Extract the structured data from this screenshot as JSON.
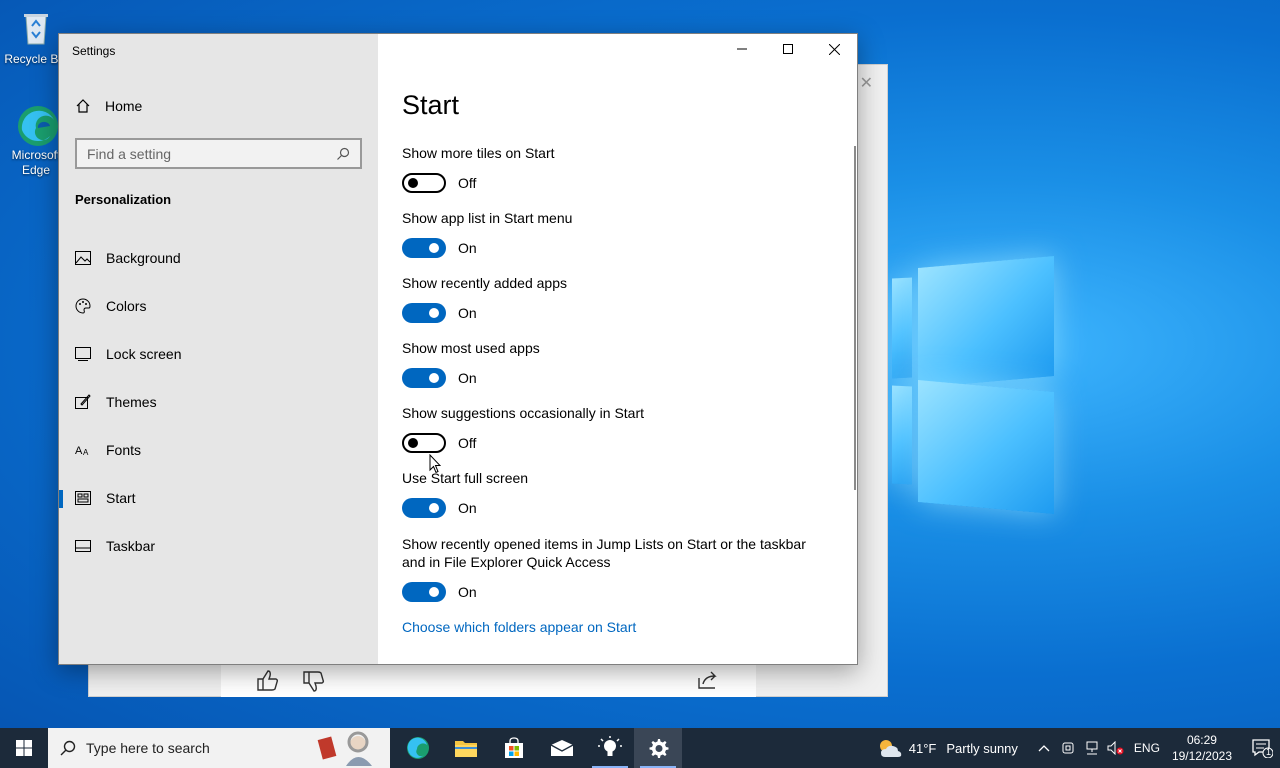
{
  "desktop": {
    "icons": [
      {
        "label": "Recycle Bin"
      },
      {
        "label": "Microsoft Edge"
      }
    ]
  },
  "window": {
    "title": "Settings",
    "controls": {
      "minimize": "minimize",
      "maximize": "maximize",
      "close": "close"
    }
  },
  "sidebar": {
    "home_label": "Home",
    "search_placeholder": "Find a setting",
    "section_label": "Personalization",
    "items": [
      {
        "label": "Background",
        "icon": "image-icon"
      },
      {
        "label": "Colors",
        "icon": "palette-icon"
      },
      {
        "label": "Lock screen",
        "icon": "lock-screen-icon"
      },
      {
        "label": "Themes",
        "icon": "themes-icon"
      },
      {
        "label": "Fonts",
        "icon": "fonts-icon"
      },
      {
        "label": "Start",
        "icon": "start-icon",
        "active": true
      },
      {
        "label": "Taskbar",
        "icon": "taskbar-icon"
      }
    ]
  },
  "main": {
    "title": "Start",
    "options": [
      {
        "label": "Show more tiles on Start",
        "state": "Off"
      },
      {
        "label": "Show app list in Start menu",
        "state": "On"
      },
      {
        "label": "Show recently added apps",
        "state": "On"
      },
      {
        "label": "Show most used apps",
        "state": "On"
      },
      {
        "label": "Show suggestions occasionally in Start",
        "state": "Off"
      },
      {
        "label": "Use Start full screen",
        "state": "On"
      },
      {
        "label": "Show recently opened items in Jump Lists on Start or the taskbar and in File Explorer Quick Access",
        "state": "On"
      }
    ],
    "link": "Choose which folders appear on Start"
  },
  "taskbar": {
    "search_placeholder": "Type here to search",
    "weather": {
      "temp": "41°F",
      "desc": "Partly sunny"
    },
    "language": "ENG",
    "time": "06:29",
    "date": "19/12/2023",
    "notification_count": "1"
  },
  "colors": {
    "accent": "#0067c0",
    "taskbar": "#1c2a3a",
    "sidebar": "#e6e6e6"
  }
}
